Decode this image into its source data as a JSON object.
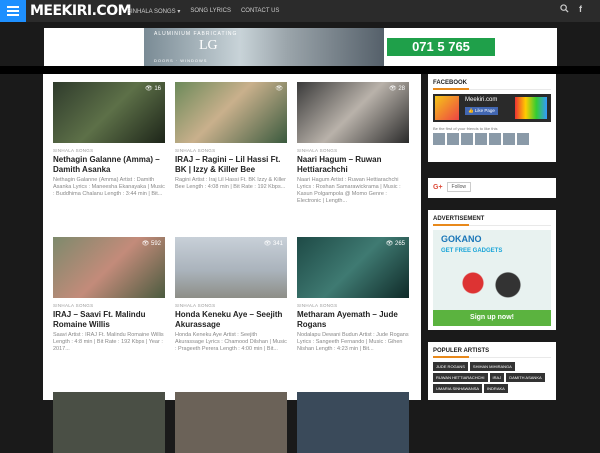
{
  "header": {
    "logo": "MEEKIRI.COM",
    "nav": [
      {
        "label": "SINHALA SONGS ▾"
      },
      {
        "label": "SONG LYRICS"
      },
      {
        "label": "CONTACT US"
      }
    ],
    "search_icon": "search-icon",
    "facebook_icon": "facebook-icon"
  },
  "banner": {
    "title": "ALUMINIUM FABRICATING",
    "brand": "LG",
    "subtitle": "DOORS · WINDOWS",
    "phone": "071 5 765"
  },
  "posts": [
    {
      "views": "16",
      "category": "SINHALA SONGS",
      "title": "Nethagin Galanne (Amma) – Damith Asanka",
      "excerpt": "Nethagin Galanne (Amma) Artist : Damith Asanka Lyrics : Maneesha Ekanayaka | Music : Buddhima Chalanu Length : 3:44 min | Bit..."
    },
    {
      "views": "",
      "category": "SINHALA SONGS",
      "title": "IRAJ – Ragini – Lil Hassi Ft. BK | Izzy & Killer Bee",
      "excerpt": "Ragini Artist : Iraj Lil Hassi Ft. BK Izzy & Killer Bee Length : 4:08 min | Bit Rate : 192 Kbps..."
    },
    {
      "views": "28",
      "category": "SINHALA SONGS",
      "title": "Naari Hagum – Ruwan Hettiarachchi",
      "excerpt": "Naari Hagum Artist : Ruwan Hettiarachchi Lyrics : Roshan Samarawickrama | Music : Kasun Polgampola @ Momo Genre : Electronic | Length..."
    },
    {
      "views": "592",
      "category": "SINHALA SONGS",
      "title": "IRAJ – Saavi Ft. Malindu Romaine Willis",
      "excerpt": "Saavi Artist : IRAJ Ft. Malindu Romaine Willis Length : 4:8 min | Bit Rate : 192 Kbps | Year : 2017..."
    },
    {
      "views": "341",
      "category": "SINHALA SONGS",
      "title": "Honda Keneku Aye – Seejith Akurassage",
      "excerpt": "Honda Keneku Aye Artist : Seejith Akurassage Lyrics : Chamood Dilshan | Music : Prageeth Perera Length : 4:00 min | Bit..."
    },
    {
      "views": "265",
      "category": "SINHALA SONGS",
      "title": "Metharam Ayemath – Jude Rogans",
      "excerpt": "Nodalapu Dewani Budun Artist : Jude Rogans Lyrics : Sangeeth Fernando | Music : Gihen Nishan Length : 4:23 min | Bit..."
    }
  ],
  "sidebar": {
    "facebook_title": "FACEBOOK",
    "fb_page_name": "Meekiri.com",
    "fb_like": "Like Page",
    "fb_friends": "Be the first of your friends to like this",
    "gplus_logo": "G+",
    "gplus_follow": "Follow",
    "ad_title": "ADVERTISEMENT",
    "ad_brand": "GOKANO",
    "ad_tagline": "GET FREE GADGETS",
    "ad_cta": "Sign up now!",
    "artists_title": "POPULER ARTISTS",
    "artists": [
      "JUDE ROGANS",
      "SHIHAN MIHIRANGA",
      "RUWAN HETTIARACHCHI",
      "IRAJ",
      "DAMITH ASANKA",
      "UMARIA SINHAWANSA",
      "INDRAKA"
    ]
  },
  "colors": {
    "accent": "#e8891b",
    "menu": "#1e90ff",
    "phone": "#1fa04a"
  }
}
